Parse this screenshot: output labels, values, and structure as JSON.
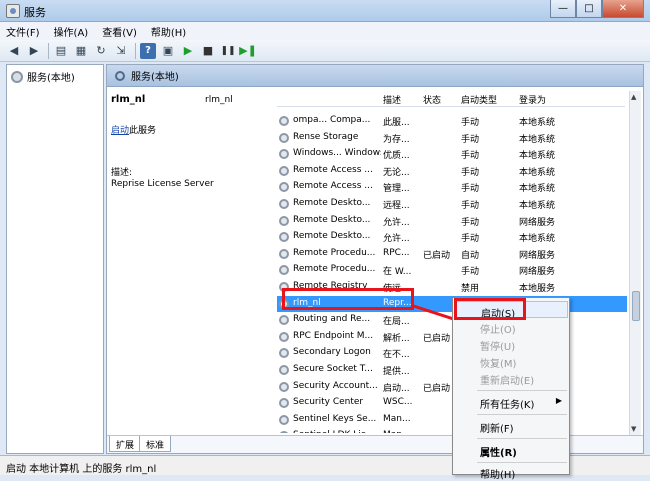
{
  "window": {
    "title": "服务",
    "minimize": "—",
    "maximize": "□",
    "close": "✕"
  },
  "menu": [
    "文件(F)",
    "操作(A)",
    "查看(V)",
    "帮助(H)"
  ],
  "left_pane": {
    "tree_item": "服务(本地)"
  },
  "right_pane": {
    "header": "服务(本地)",
    "selected_name": "rlm_nl",
    "action_link": "启动",
    "action_suffix": "此服务",
    "desc_label": "描述:",
    "description": "Reprise License Server",
    "overlap_name": "rlm_nl"
  },
  "columns": {
    "desc": "描述",
    "status": "状态",
    "startup": "启动类型",
    "logon": "登录为"
  },
  "services": [
    {
      "name": "ompa... Compa...",
      "desc": "此服...",
      "status": "",
      "startup": "手动",
      "logon": "本地系统"
    },
    {
      "name": "Rense Storage",
      "desc": "为存...",
      "status": "",
      "startup": "手动",
      "logon": "本地系统"
    },
    {
      "name": "Windows... Windows...",
      "desc": "优质...",
      "status": "",
      "startup": "手动",
      "logon": "本地系统"
    },
    {
      "name": "Remote Access ...",
      "desc": "无论...",
      "status": "",
      "startup": "手动",
      "logon": "本地系统"
    },
    {
      "name": "Remote Access ...",
      "desc": "管理...",
      "status": "",
      "startup": "手动",
      "logon": "本地系统"
    },
    {
      "name": "Remote Deskto...",
      "desc": "远程...",
      "status": "",
      "startup": "手动",
      "logon": "本地系统"
    },
    {
      "name": "Remote Deskto...",
      "desc": "允许...",
      "status": "",
      "startup": "手动",
      "logon": "网络服务"
    },
    {
      "name": "Remote Deskto...",
      "desc": "允许...",
      "status": "",
      "startup": "手动",
      "logon": "本地系统"
    },
    {
      "name": "Remote Procedu...",
      "desc": "RPC...",
      "status": "已启动",
      "startup": "自动",
      "logon": "网络服务"
    },
    {
      "name": "Remote Procedu...",
      "desc": "在 W...",
      "status": "",
      "startup": "手动",
      "logon": "网络服务"
    },
    {
      "name": "Remote Registry",
      "desc": "使远...",
      "status": "",
      "startup": "禁用",
      "logon": "本地服务"
    },
    {
      "name": "rlm_nl",
      "desc": "Repr...",
      "status": "",
      "startup": "手动",
      "logon": "本地系统"
    },
    {
      "name": "Routing and Re...",
      "desc": "在局...",
      "status": "",
      "startup": "禁用",
      "logon": "本地系统"
    },
    {
      "name": "RPC Endpoint M...",
      "desc": "解析...",
      "status": "已启动",
      "startup": "自动",
      "logon": "网络服务"
    },
    {
      "name": "Secondary Logon",
      "desc": "在不...",
      "status": "",
      "startup": "手动",
      "logon": "本地系统"
    },
    {
      "name": "Secure Socket T...",
      "desc": "提供...",
      "status": "",
      "startup": "手动",
      "logon": "本地服务"
    },
    {
      "name": "Security Account...",
      "desc": "启动...",
      "status": "已启动",
      "startup": "自动",
      "logon": "本地系统"
    },
    {
      "name": "Security Center",
      "desc": "WSC...",
      "status": "",
      "startup": "",
      "logon": ""
    },
    {
      "name": "Sentinel Keys Se...",
      "desc": "Man...",
      "status": "",
      "startup": "",
      "logon": ""
    },
    {
      "name": "Sentinel LDK Lic...",
      "desc": "Man...",
      "status": "",
      "startup": "",
      "logon": ""
    }
  ],
  "context_menu": [
    {
      "label": "启动(S)"
    },
    {
      "label": "停止(O)"
    },
    {
      "label": "暂停(U)"
    },
    {
      "label": "恢复(M)"
    },
    {
      "label": "重新启动(E)"
    },
    {
      "label": "所有任务(K)"
    },
    {
      "label": "刷新(F)"
    },
    {
      "label": "属性(R)"
    },
    {
      "label": "帮助(H)"
    }
  ],
  "tabs": [
    "扩展",
    "标准"
  ],
  "status_bar": "启动 本地计算机 上的服务 rlm_nl",
  "colors": {
    "selection": "#3399ff",
    "annotation_red": "#e8141b",
    "link": "#1546a8"
  }
}
